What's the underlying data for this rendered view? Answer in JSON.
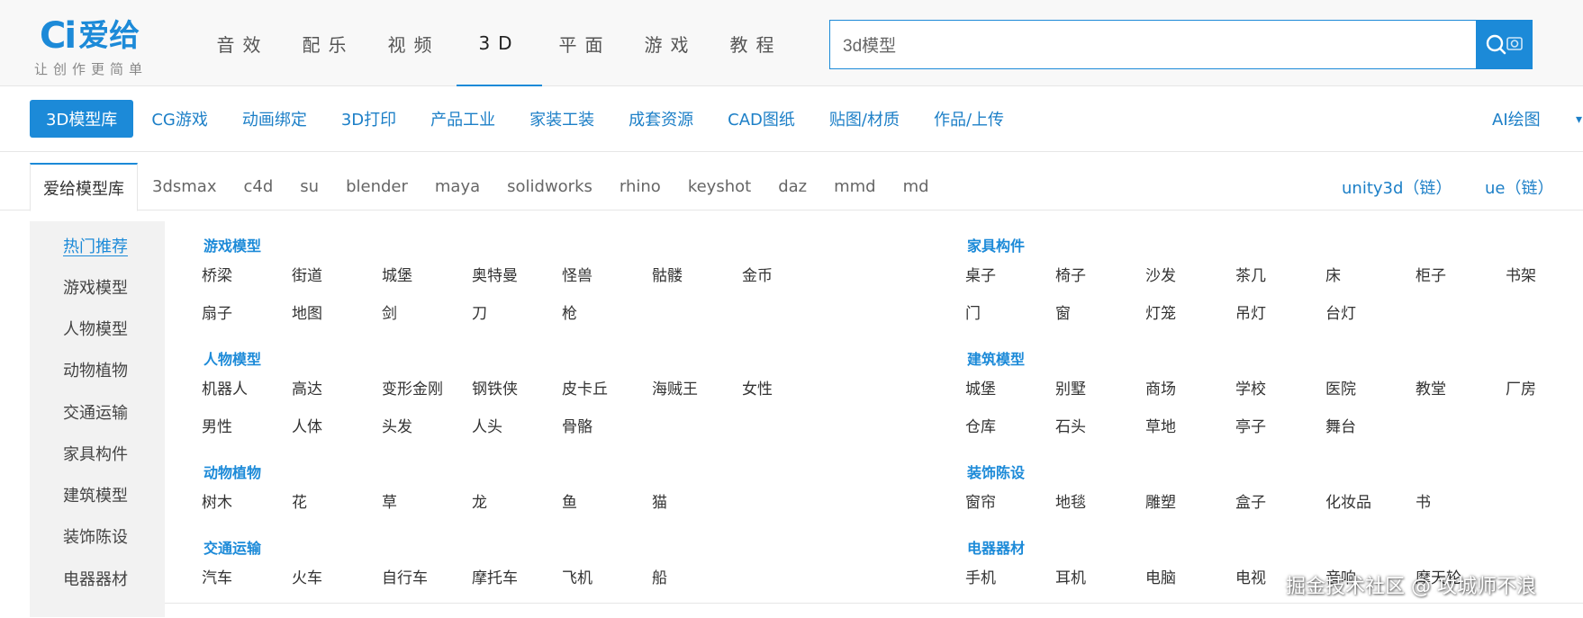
{
  "logo": {
    "mark": "Ci",
    "name": "爱给",
    "slogan": "让创作更简单"
  },
  "main_nav": [
    "音效",
    "配乐",
    "视频",
    "3D",
    "平面",
    "游戏",
    "教程"
  ],
  "search": {
    "value": "3d模型",
    "button_icon": "search-icon"
  },
  "categories": [
    "3D模型库",
    "CG游戏",
    "动画绑定",
    "3D打印",
    "产品工业",
    "家装工装",
    "成套资源",
    "CAD图纸",
    "贴图/材质",
    "作品/上传"
  ],
  "categories_right": "AI绘图",
  "software_tabs": [
    "爱给模型库",
    "3dsmax",
    "c4d",
    "su",
    "blender",
    "maya",
    "solidworks",
    "rhino",
    "keyshot",
    "daz",
    "mmd",
    "md"
  ],
  "software_right": [
    "unity3d（链）",
    "ue（链）"
  ],
  "sidebar": [
    "热门推荐",
    "游戏模型",
    "人物模型",
    "动物植物",
    "交通运输",
    "家具构件",
    "建筑模型",
    "装饰陈设",
    "电器器材"
  ],
  "groups": [
    {
      "title": "游戏模型",
      "rows": [
        [
          "桥梁",
          "街道",
          "城堡",
          "奥特曼",
          "怪兽",
          "骷髅",
          "金币"
        ],
        [
          "扇子",
          "地图",
          "剑",
          "刀",
          "枪"
        ]
      ]
    },
    {
      "title": "人物模型",
      "rows": [
        [
          "机器人",
          "高达",
          "变形金刚",
          "钢铁侠",
          "皮卡丘",
          "海贼王",
          "女性"
        ],
        [
          "男性",
          "人体",
          "头发",
          "人头",
          "骨骼"
        ]
      ]
    },
    {
      "title": "动物植物",
      "rows": [
        [
          "树木",
          "花",
          "草",
          "龙",
          "鱼",
          "猫"
        ]
      ]
    },
    {
      "title": "交通运输",
      "rows": [
        [
          "汽车",
          "火车",
          "自行车",
          "摩托车",
          "飞机",
          "船"
        ]
      ]
    },
    {
      "title": "家具构件",
      "rows": [
        [
          "桌子",
          "椅子",
          "沙发",
          "茶几",
          "床",
          "柜子",
          "书架"
        ],
        [
          "门",
          "窗",
          "灯笼",
          "吊灯",
          "台灯"
        ]
      ]
    },
    {
      "title": "建筑模型",
      "rows": [
        [
          "城堡",
          "别墅",
          "商场",
          "学校",
          "医院",
          "教堂",
          "厂房"
        ],
        [
          "仓库",
          "石头",
          "草地",
          "亭子",
          "舞台"
        ]
      ]
    },
    {
      "title": "装饰陈设",
      "rows": [
        [
          "窗帘",
          "地毯",
          "雕塑",
          "盒子",
          "化妆品",
          "书"
        ]
      ]
    },
    {
      "title": "电器器材",
      "rows": [
        [
          "手机",
          "耳机",
          "电脑",
          "电视",
          "音响",
          "摩天轮"
        ]
      ]
    }
  ],
  "watermark": "掘金技术社区 @ 攻城师不浪",
  "colors": {
    "accent": "#1c8ad8",
    "link": "#1c7fc7",
    "sidebar_bg": "#f2f2f2",
    "header_bg": "#f8f8f8"
  }
}
